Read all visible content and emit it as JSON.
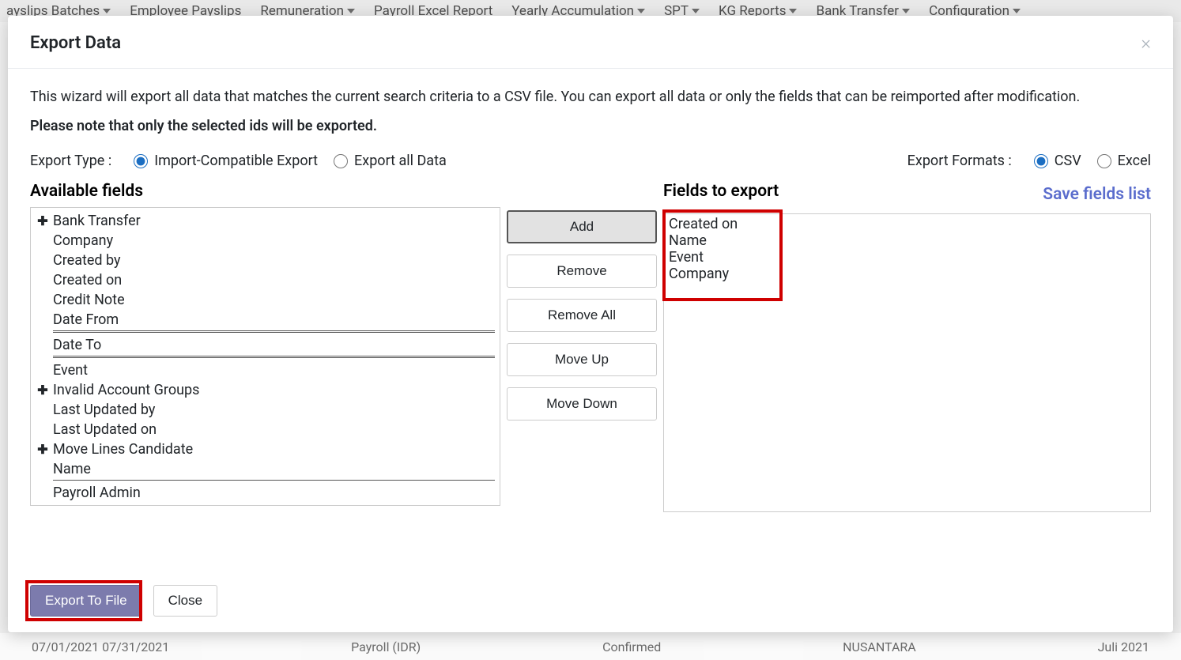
{
  "nav": {
    "items": [
      "ayslips Batches",
      "Employee Payslips",
      "Remuneration",
      "Payroll Excel Report",
      "Yearly Accumulation",
      "SPT",
      "KG Reports",
      "Bank Transfer",
      "Configuration"
    ]
  },
  "bg_row": {
    "dates": "07/01/2021   07/31/2021",
    "payroll": "Payroll (IDR)",
    "status": "Confirmed",
    "company": "NUSANTARA",
    "period": "Juli 2021"
  },
  "modal": {
    "title": "Export Data",
    "intro_text": "This wizard will export all data that matches the current search criteria to a CSV file. You can export all data or only the fields that can be reimported after modification.",
    "intro_bold": "Please note that only the selected ids will be exported.",
    "export_type_label": "Export Type :",
    "radio_compat": "Import-Compatible Export",
    "radio_all": "Export all Data",
    "export_formats_label": "Export Formats :",
    "radio_csv": "CSV",
    "radio_excel": "Excel"
  },
  "available": {
    "heading": "Available fields",
    "items": [
      {
        "label": "Bank Transfer",
        "expandable": true
      },
      {
        "label": "Company",
        "expandable": false
      },
      {
        "label": "Created by",
        "expandable": false
      },
      {
        "label": "Created on",
        "expandable": false
      },
      {
        "label": "Credit Note",
        "expandable": false
      },
      {
        "label": "Date From",
        "expandable": false,
        "sep_after": "double"
      },
      {
        "label": "Date To",
        "expandable": false,
        "sep_after": "double"
      },
      {
        "label": "Event",
        "expandable": false
      },
      {
        "label": "Invalid Account Groups",
        "expandable": true
      },
      {
        "label": "Last Updated by",
        "expandable": false
      },
      {
        "label": "Last Updated on",
        "expandable": false
      },
      {
        "label": "Move Lines Candidate",
        "expandable": true
      },
      {
        "label": "Name",
        "expandable": false,
        "sep_after": "single"
      },
      {
        "label": "Payroll Admin",
        "expandable": false
      }
    ]
  },
  "buttons": {
    "add": "Add",
    "remove": "Remove",
    "remove_all": "Remove All",
    "move_up": "Move Up",
    "move_down": "Move Down"
  },
  "export_fields": {
    "heading": "Fields to export",
    "save_link": "Save fields list",
    "items": [
      "Created on",
      "Name",
      "Event",
      "Company"
    ]
  },
  "footer": {
    "export_btn": "Export To File",
    "close_btn": "Close"
  }
}
